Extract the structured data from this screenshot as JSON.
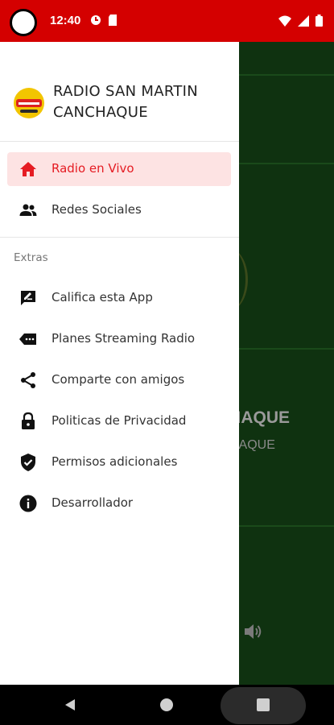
{
  "status_bar": {
    "time": "12:40",
    "icons_left": [
      "data-saver-icon",
      "sd-card-icon"
    ],
    "icons_right": [
      "wifi-icon",
      "signal-icon",
      "battery-icon"
    ]
  },
  "drawer": {
    "app_title": "RADIO SAN MARTIN CANCHAQUE",
    "primary_items": [
      {
        "label": "Radio en Vivo",
        "icon": "home-icon",
        "active": true
      },
      {
        "label": "Redes Sociales",
        "icon": "people-icon",
        "active": false
      }
    ],
    "section_label": "Extras",
    "extra_items": [
      {
        "label": "Califica esta App",
        "icon": "rate-review-icon"
      },
      {
        "label": "Planes Streaming Radio",
        "icon": "label-tag-icon"
      },
      {
        "label": "Comparte con amigos",
        "icon": "share-icon"
      },
      {
        "label": "Politicas de Privacidad",
        "icon": "lock-icon"
      },
      {
        "label": "Permisos adicionales",
        "icon": "shield-check-icon"
      },
      {
        "label": "Desarrollador",
        "icon": "info-icon"
      }
    ]
  },
  "background_app": {
    "title_fragment": "CHAQUE",
    "subtitle_fragment": "HAQUE"
  },
  "colors": {
    "status_bar": "#d40000",
    "accent": "#e51c23",
    "active_item_bg": "#fde3e3",
    "background_app": "#0f3210"
  }
}
